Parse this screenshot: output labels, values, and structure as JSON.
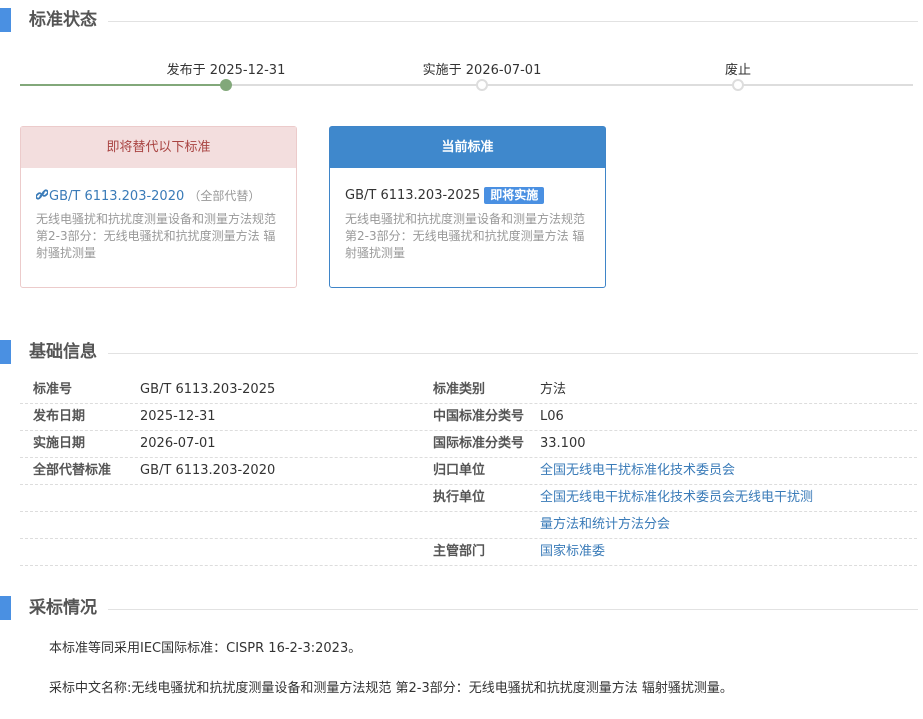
{
  "status_section": {
    "title": "标准状态",
    "timeline": {
      "steps": [
        {
          "label": "发布于 2025-12-31"
        },
        {
          "label": "实施于 2026-07-01"
        },
        {
          "label": "废止"
        }
      ],
      "current_step": 1
    },
    "replaced_card": {
      "header": "即将替代以下标准",
      "code": "GB/T 6113.203-2020",
      "note": "（全部代替）",
      "description": "无线电骚扰和抗扰度测量设备和测量方法规范 第2-3部分：无线电骚扰和抗扰度测量方法 辐射骚扰测量"
    },
    "current_card": {
      "header": "当前标准",
      "code": "GB/T 6113.203-2025",
      "badge": "即将实施",
      "description": "无线电骚扰和抗扰度测量设备和测量方法规范 第2-3部分：无线电骚扰和抗扰度测量方法 辐射骚扰测量"
    }
  },
  "basic_section": {
    "title": "基础信息",
    "rows": [
      {
        "l1": "标准号",
        "v1": "GB/T 6113.203-2025",
        "l2": "标准类别",
        "v2": "方法"
      },
      {
        "l1": "发布日期",
        "v1": "2025-12-31",
        "l2": "中国标准分类号",
        "v2": "L06"
      },
      {
        "l1": "实施日期",
        "v1": "2026-07-01",
        "l2": "国际标准分类号",
        "v2": "33.100"
      },
      {
        "l1": "全部代替标准",
        "v1": "GB/T 6113.203-2020",
        "l2": "归口单位",
        "v2": "全国无线电干扰标准化技术委员会"
      },
      {
        "l1": "",
        "v1": "",
        "l2": "执行单位",
        "v2": "全国无线电干扰标准化技术委员会无线电干扰测"
      },
      {
        "l1": "",
        "v1": "",
        "l2": "",
        "v2": "量方法和统计方法分会"
      },
      {
        "l1": "",
        "v1": "",
        "l2": "主管部门",
        "v2": "国家标准委"
      }
    ]
  },
  "adoption_section": {
    "title": "采标情况",
    "line1": "本标准等同采用IEC国际标准：CISPR 16-2-3:2023。",
    "line2": "采标中文名称:无线电骚扰和抗扰度测量设备和测量方法规范 第2-3部分：无线电骚扰和抗扰度测量方法 辐射骚扰测量。"
  },
  "colors": {
    "accent": "#4a90e2",
    "timeline_progress": "#82a87a",
    "link": "#3a7bb8",
    "replaced_header_bg": "#f3dede",
    "replaced_header_text": "#a94442",
    "current_header_bg": "#3f88cc"
  },
  "icons": {
    "link": "link-icon"
  }
}
